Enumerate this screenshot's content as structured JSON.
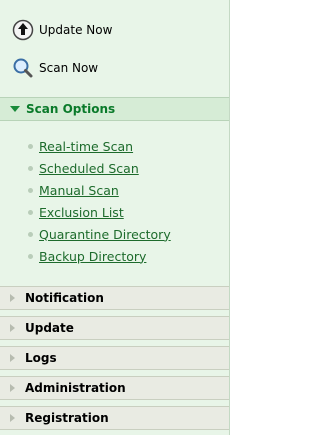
{
  "actions": {
    "update_now": "Update Now",
    "scan_now": "Scan Now"
  },
  "scan_options": {
    "title": "Scan Options",
    "items": [
      "Real-time Scan",
      "Scheduled Scan",
      "Manual Scan",
      "Exclusion List",
      "Quarantine Directory",
      "Backup Directory"
    ]
  },
  "sections": [
    "Notification",
    "Update",
    "Logs",
    "Administration",
    "Registration"
  ],
  "colors": {
    "panel_bg": "#e8f5e8",
    "accent": "#0a7a2a",
    "link": "#1d6b2c",
    "collapsed_header_bg": "#e9ebe3"
  }
}
